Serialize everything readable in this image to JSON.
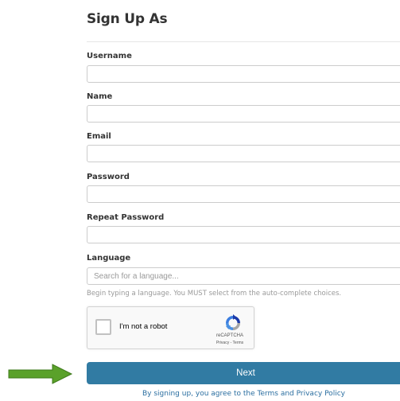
{
  "form": {
    "title": "Sign Up As",
    "fields": {
      "username": {
        "label": "Username",
        "value": "",
        "placeholder": ""
      },
      "name": {
        "label": "Name",
        "value": "",
        "placeholder": ""
      },
      "email": {
        "label": "Email",
        "value": "",
        "placeholder": ""
      },
      "password": {
        "label": "Password",
        "value": "",
        "placeholder": ""
      },
      "repeat_password": {
        "label": "Repeat Password",
        "value": "",
        "placeholder": ""
      },
      "language": {
        "label": "Language",
        "value": "",
        "placeholder": "Search for a language...",
        "help": "Begin typing a language. You MUST select from the auto-complete choices."
      }
    },
    "captcha": {
      "label": "I'm not a robot",
      "brand": "reCAPTCHA",
      "links": "Privacy - Terms",
      "checked": false
    },
    "next_label": "Next",
    "terms_text": "By signing up, you agree to the Terms and Privacy Policy"
  },
  "annotation": {
    "arrow_color": "#5aa12a",
    "arrow_icon": "right-arrow-icon"
  },
  "colors": {
    "button": "#317ba3",
    "link": "#2a6ea0"
  }
}
